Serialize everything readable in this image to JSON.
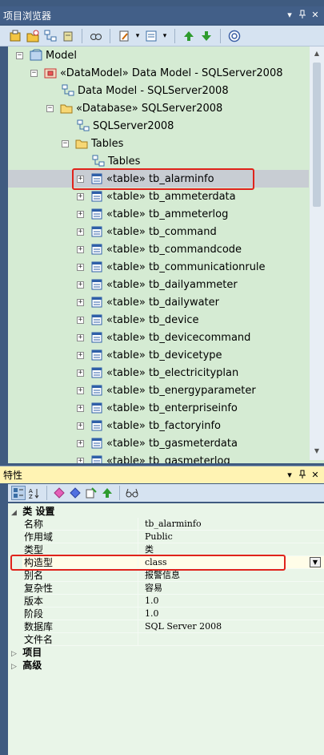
{
  "browser": {
    "title": "项目浏览器",
    "ctrl_dropdown": "▾",
    "ctrl_pin": "ㅁ",
    "ctrl_close": "✕"
  },
  "tree": {
    "root": "Model",
    "datamodel_pkg": "«DataModel» Data Model - SQLServer2008",
    "datamodel_diag": "Data Model - SQLServer2008",
    "database_pkg": "«Database» SQLServer2008",
    "database_diag": "SQLServer2008",
    "tables_folder": "Tables",
    "tables_diag": "Tables",
    "tables": [
      "«table» tb_alarminfo",
      "«table» tb_ammeterdata",
      "«table» tb_ammeterlog",
      "«table» tb_command",
      "«table» tb_commandcode",
      "«table» tb_communicationrule",
      "«table» tb_dailyammeter",
      "«table» tb_dailywater",
      "«table» tb_device",
      "«table» tb_devicecommand",
      "«table» tb_devicetype",
      "«table» tb_electricityplan",
      "«table» tb_energyparameter",
      "«table» tb_enterpriseinfo",
      "«table» tb_factoryinfo",
      "«table» tb_gasmeterdata",
      "«table» tb_gasmeterlog"
    ]
  },
  "properties": {
    "title": "特性",
    "category_class": "类 设置",
    "rows": [
      {
        "name": "名称",
        "value": "tb_alarminfo"
      },
      {
        "name": "作用域",
        "value": "Public"
      },
      {
        "name": "类型",
        "value": "类"
      },
      {
        "name": "构造型",
        "value": "class"
      },
      {
        "name": "别名",
        "value": "报警信息"
      },
      {
        "name": "复杂性",
        "value": "容易"
      },
      {
        "name": "版本",
        "value": "1.0"
      },
      {
        "name": "阶段",
        "value": "1.0"
      },
      {
        "name": "数据库",
        "value": "SQL Server 2008"
      },
      {
        "name": "文件名",
        "value": ""
      }
    ],
    "category_project": "项目",
    "category_advanced": "高级"
  }
}
